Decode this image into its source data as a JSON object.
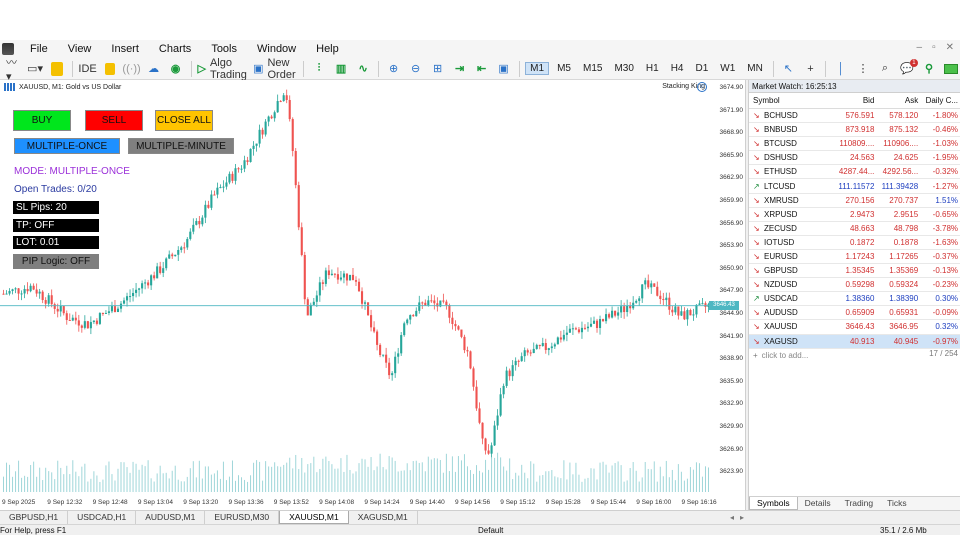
{
  "menu": [
    "File",
    "View",
    "Insert",
    "Charts",
    "Tools",
    "Window",
    "Help"
  ],
  "toolbar": {
    "ide": "IDE",
    "algo_trading": "Algo Trading",
    "new_order": "New Order",
    "timeframes": [
      "M1",
      "M5",
      "M15",
      "M30",
      "H1",
      "H4",
      "D1",
      "W1",
      "MN"
    ],
    "active_timeframe": "M1",
    "notif_count": "1"
  },
  "chart": {
    "header": "XAUUSD, M1:  Gold vs US Dollar",
    "ea_name": "Stacking King",
    "current_price": "3646.43",
    "price_labels": [
      "3674.90",
      "3671.90",
      "3668.90",
      "3665.90",
      "3662.90",
      "3659.90",
      "3656.90",
      "3653.90",
      "3650.90",
      "3647.90",
      "3644.90",
      "3641.90",
      "3638.90",
      "3635.90",
      "3632.90",
      "3629.90",
      "3626.90",
      "3623.90"
    ],
    "time_labels": [
      "9 Sep 2025",
      "9 Sep 12:32",
      "9 Sep 12:48",
      "9 Sep 13:04",
      "9 Sep 13:20",
      "9 Sep 13:36",
      "9 Sep 13:52",
      "9 Sep 14:08",
      "9 Sep 14:24",
      "9 Sep 14:40",
      "9 Sep 14:56",
      "9 Sep 15:12",
      "9 Sep 15:28",
      "9 Sep 15:44",
      "9 Sep 16:00",
      "9 Sep 16:16"
    ],
    "colors": {
      "bull": "#26a69a",
      "bear": "#ef5350",
      "price_line": "#4eb7c2",
      "volume": "#9fd6d9"
    }
  },
  "ea_panel": {
    "buy": "BUY",
    "sell": "SELL",
    "close_all": "CLOSE ALL",
    "multiple_once": "MULTIPLE-ONCE",
    "multiple_minute": "MULTIPLE-MINUTE",
    "mode": "MODE: MULTIPLE-ONCE",
    "open_trades": "Open Trades: 0/20",
    "sl": "SL Pips: 20",
    "tp": "TP: OFF",
    "lot": "LOT: 0.01",
    "pip_logic": "PIP Logic: OFF",
    "colors": {
      "buy": "#00e61c",
      "sell": "#ff0000",
      "close_all": "#ffc400",
      "multiple_once": "#1e90ff",
      "multiple_minute": "#7f7f7f",
      "mode_text": "#9b30d9",
      "open_trades_text": "#2a3aa0"
    }
  },
  "market_watch": {
    "title": "Market Watch: 16:25:13",
    "headers": [
      "Symbol",
      "Bid",
      "Ask",
      "Daily C..."
    ],
    "rows": [
      {
        "symbol": "BCHUSD",
        "dir": "down",
        "bid": "576.591",
        "ask": "578.120",
        "chg": "-1.80%"
      },
      {
        "symbol": "BNBUSD",
        "dir": "down",
        "bid": "873.918",
        "ask": "875.132",
        "chg": "-0.46%"
      },
      {
        "symbol": "BTCUSD",
        "dir": "down",
        "bid": "110809....",
        "ask": "110906....",
        "chg": "-1.03%"
      },
      {
        "symbol": "DSHUSD",
        "dir": "down",
        "bid": "24.563",
        "ask": "24.625",
        "chg": "-1.95%"
      },
      {
        "symbol": "ETHUSD",
        "dir": "down",
        "bid": "4287.44...",
        "ask": "4292.56...",
        "chg": "-0.32%"
      },
      {
        "symbol": "LTCUSD",
        "dir": "up",
        "bid": "111.11572",
        "ask": "111.39428",
        "chg": "-1.27%"
      },
      {
        "symbol": "XMRUSD",
        "dir": "down",
        "bid": "270.156",
        "ask": "270.737",
        "chg": "1.51%"
      },
      {
        "symbol": "XRPUSD",
        "dir": "down",
        "bid": "2.9473",
        "ask": "2.9515",
        "chg": "-0.65%"
      },
      {
        "symbol": "ZECUSD",
        "dir": "down",
        "bid": "48.663",
        "ask": "48.798",
        "chg": "-3.78%"
      },
      {
        "symbol": "IOTUSD",
        "dir": "down",
        "bid": "0.1872",
        "ask": "0.1878",
        "chg": "-1.63%"
      },
      {
        "symbol": "EURUSD",
        "dir": "down",
        "bid": "1.17243",
        "ask": "1.17265",
        "chg": "-0.37%"
      },
      {
        "symbol": "GBPUSD",
        "dir": "down",
        "bid": "1.35345",
        "ask": "1.35369",
        "chg": "-0.13%"
      },
      {
        "symbol": "NZDUSD",
        "dir": "down",
        "bid": "0.59298",
        "ask": "0.59324",
        "chg": "-0.23%"
      },
      {
        "symbol": "USDCAD",
        "dir": "up",
        "bid": "1.38360",
        "ask": "1.38390",
        "chg": "0.30%"
      },
      {
        "symbol": "AUDUSD",
        "dir": "down",
        "bid": "0.65909",
        "ask": "0.65931",
        "chg": "-0.09%"
      },
      {
        "symbol": "XAUUSD",
        "dir": "down",
        "bid": "3646.43",
        "ask": "3646.95",
        "chg": "0.32%"
      },
      {
        "symbol": "XAGUSD",
        "dir": "down",
        "bid": "40.913",
        "ask": "40.945",
        "chg": "-0.97%"
      }
    ],
    "add_label": "click to add...",
    "count": "17 / 254",
    "tabs": [
      "Symbols",
      "Details",
      "Trading",
      "Ticks"
    ]
  },
  "chart_tabs": [
    "GBPUSD,H1",
    "USDCAD,H1",
    "AUDUSD,M1",
    "EURUSD,M30",
    "XAUUSD,M1",
    "XAGUSD,M1"
  ],
  "active_chart_tab": "XAUUSD,M1",
  "status": {
    "help": "For Help, press F1",
    "profile": "Default",
    "traffic": "35.1 / 2.6 Mb"
  }
}
